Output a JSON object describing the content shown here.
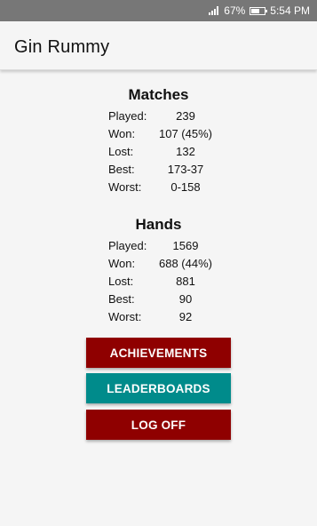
{
  "status_bar": {
    "battery": "67%",
    "time": "5:54 PM",
    "battery_level": 0.67
  },
  "app_bar": {
    "title": "Gin Rummy"
  },
  "matches": {
    "title": "Matches",
    "rows": [
      {
        "label": "Played:",
        "value": "239"
      },
      {
        "label": "Won:",
        "value": "107 (45%)"
      },
      {
        "label": "Lost:",
        "value": "132"
      },
      {
        "label": "Best:",
        "value": "173-37"
      },
      {
        "label": "Worst:",
        "value": "0-158"
      }
    ]
  },
  "hands": {
    "title": "Hands",
    "rows": [
      {
        "label": "Played:",
        "value": "1569"
      },
      {
        "label": "Won:",
        "value": "688 (44%)"
      },
      {
        "label": "Lost:",
        "value": "881"
      },
      {
        "label": "Best:",
        "value": "90"
      },
      {
        "label": "Worst:",
        "value": "92"
      }
    ]
  },
  "buttons": {
    "achievements": "ACHIEVEMENTS",
    "leaderboards": "LEADERBOARDS",
    "log_off": "LOG OFF"
  },
  "colors": {
    "red": "#8f0000",
    "teal": "#008b8b",
    "status_bar": "#777777"
  }
}
